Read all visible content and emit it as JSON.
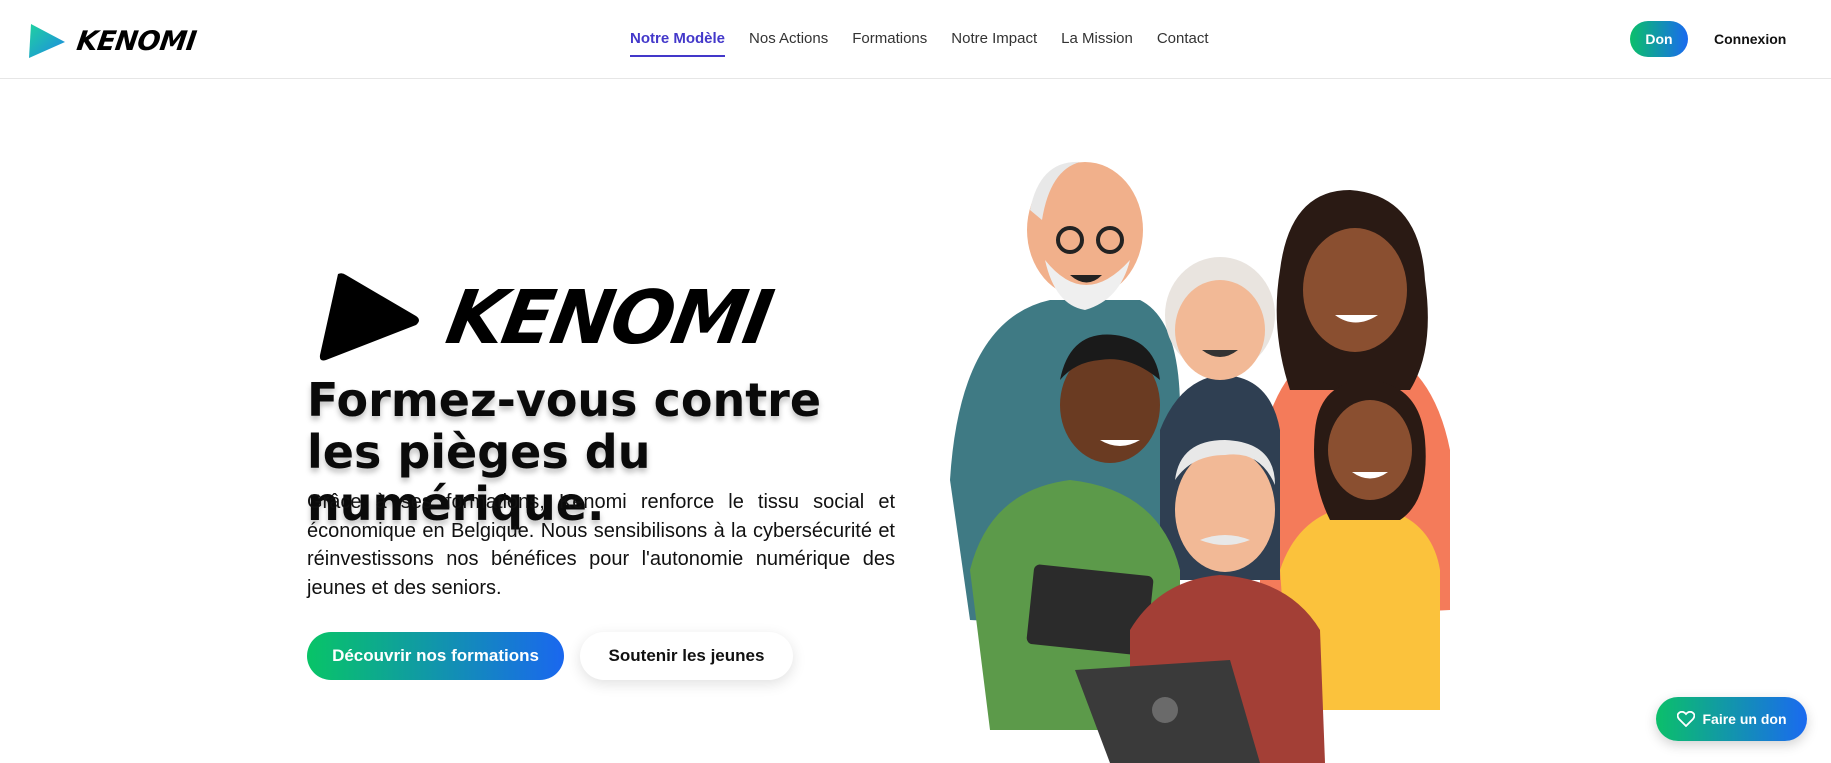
{
  "brand": {
    "name": "KENOMI"
  },
  "nav": [
    {
      "label": "Notre Modèle",
      "active": true
    },
    {
      "label": "Nos Actions",
      "active": false
    },
    {
      "label": "Formations",
      "active": false
    },
    {
      "label": "Notre Impact",
      "active": false
    },
    {
      "label": "La Mission",
      "active": false
    },
    {
      "label": "Contact",
      "active": false
    }
  ],
  "header_actions": {
    "donate_label": "Don",
    "login_label": "Connexion"
  },
  "hero": {
    "logo_text": "KENOMI",
    "title": "Formez-vous contre les pièges du numérique.",
    "description": "Grâce à ses formations, Kenomi renforce le tissu social et économique en Belgique. Nous sensibilisons à la cybersécurité et réinvestissons nos bénéfices pour l'autonomie numérique des jeunes et des seniors.",
    "primary_cta": "Découvrir nos formations",
    "secondary_cta": "Soutenir les jeunes"
  },
  "floating_donate": {
    "label": "Faire un don",
    "icon": "heart-icon"
  },
  "colors": {
    "accent": "#4338ca",
    "gradient_start": "#08c467",
    "gradient_end": "#1a67ef"
  }
}
